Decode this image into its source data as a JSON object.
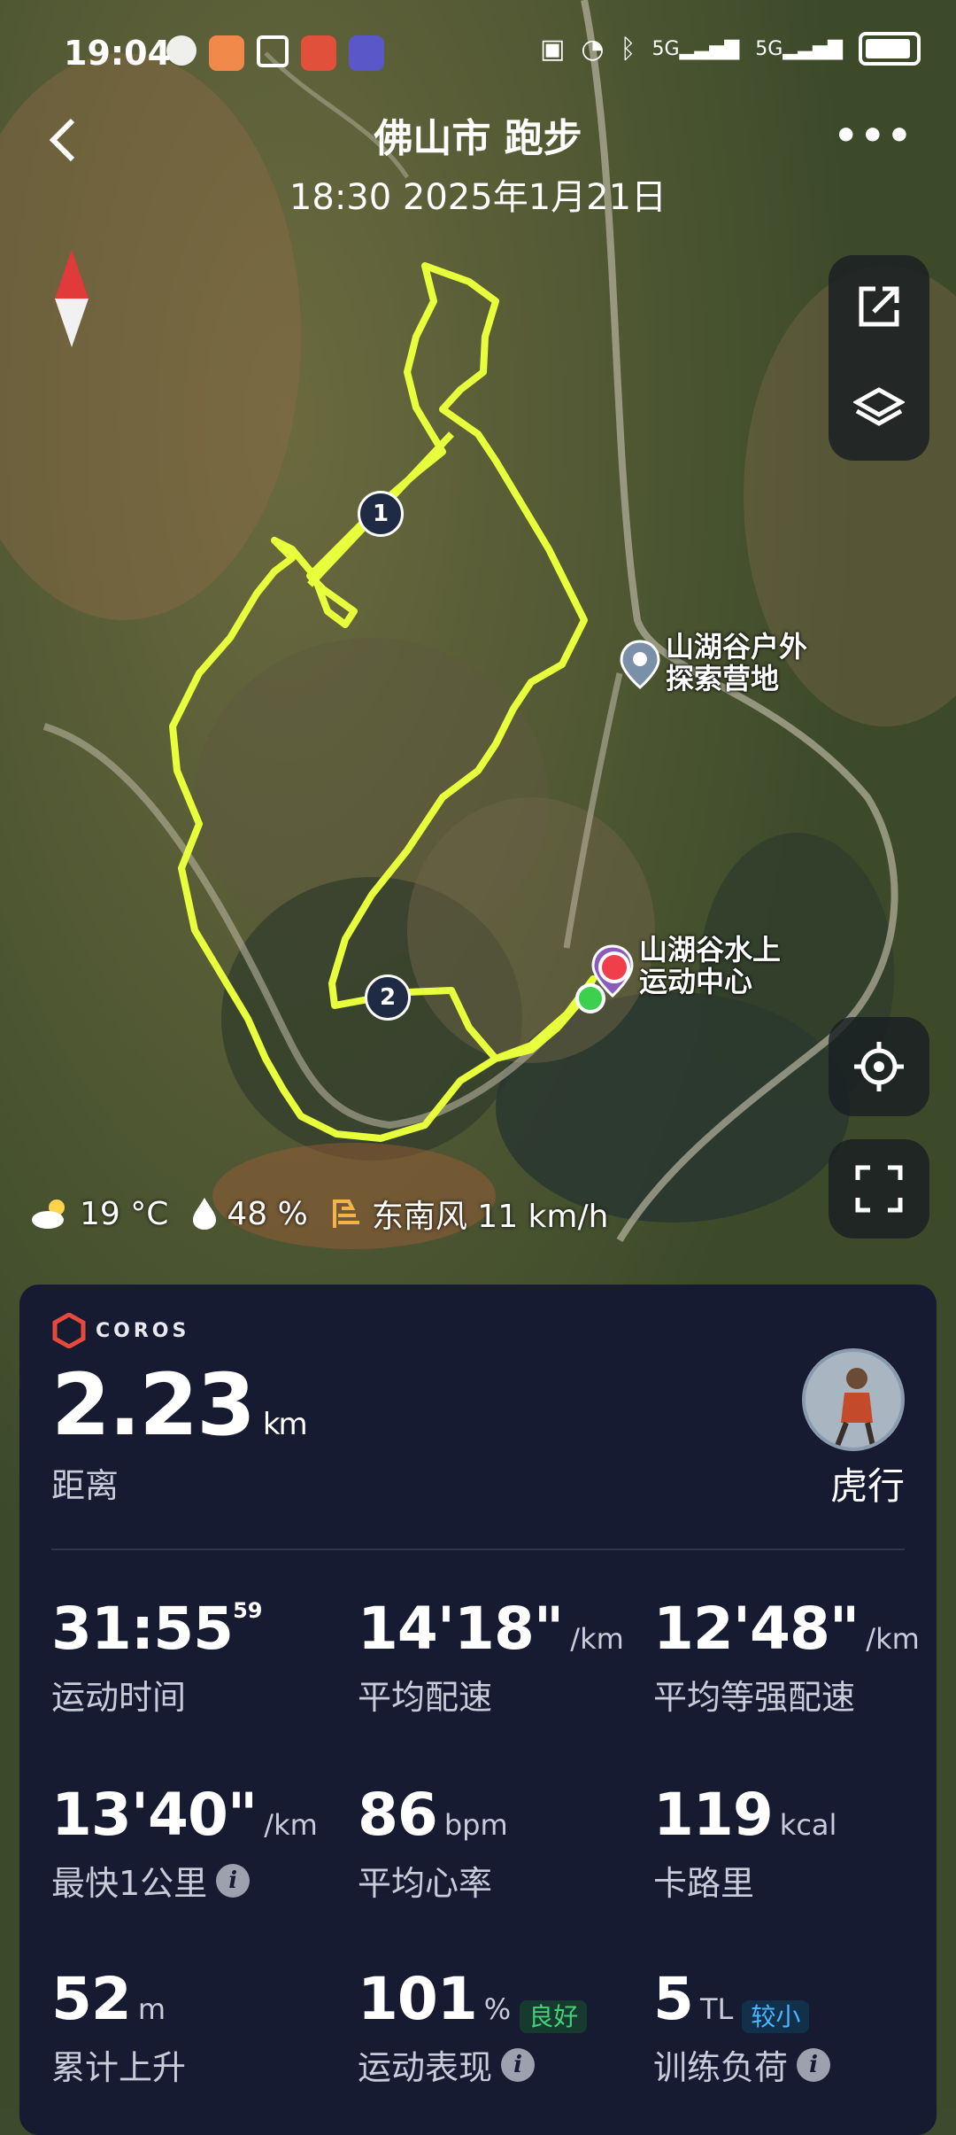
{
  "status_bar": {
    "time": "19:04",
    "network_1": "5G",
    "network_2": "5G"
  },
  "header": {
    "title": "佛山市 跑步",
    "subtitle": "18:30 2025年1月21日",
    "more": "•••"
  },
  "map": {
    "poi_1": {
      "line1": "山湖谷户外",
      "line2": "探索营地"
    },
    "poi_2": {
      "line1": "山湖谷水上",
      "line2": "运动中心"
    },
    "km_markers": [
      "1",
      "2"
    ],
    "route_color": "#e8ff3c"
  },
  "weather": {
    "temp": "19 °C",
    "humidity": "48  %",
    "wind": "东南风 11 km/h"
  },
  "card": {
    "brand": "COROS",
    "distance": {
      "value": "2.23",
      "unit": "km",
      "label": "距离"
    },
    "user": {
      "name": "虎行"
    },
    "stats": [
      {
        "value": "31:55",
        "sup": "59",
        "unit": "",
        "label": "运动时间"
      },
      {
        "value": "14'18\"",
        "unit": "/km",
        "label": "平均配速"
      },
      {
        "value": "12'48\"",
        "unit": "/km",
        "label": "平均等强配速"
      },
      {
        "value": "13'40\"",
        "unit": "/km",
        "label": "最快1公里"
      },
      {
        "value": "86",
        "unit": "bpm",
        "label": "平均心率"
      },
      {
        "value": "119",
        "unit": "kcal",
        "label": "卡路里"
      },
      {
        "value": "52",
        "unit": "m",
        "label": "累计上升"
      },
      {
        "value": "101",
        "unit": "%",
        "badge": "良好",
        "label": "运动表现"
      },
      {
        "value": "5",
        "unit": "TL",
        "badge": "较小",
        "label": "训练负荷"
      }
    ]
  }
}
